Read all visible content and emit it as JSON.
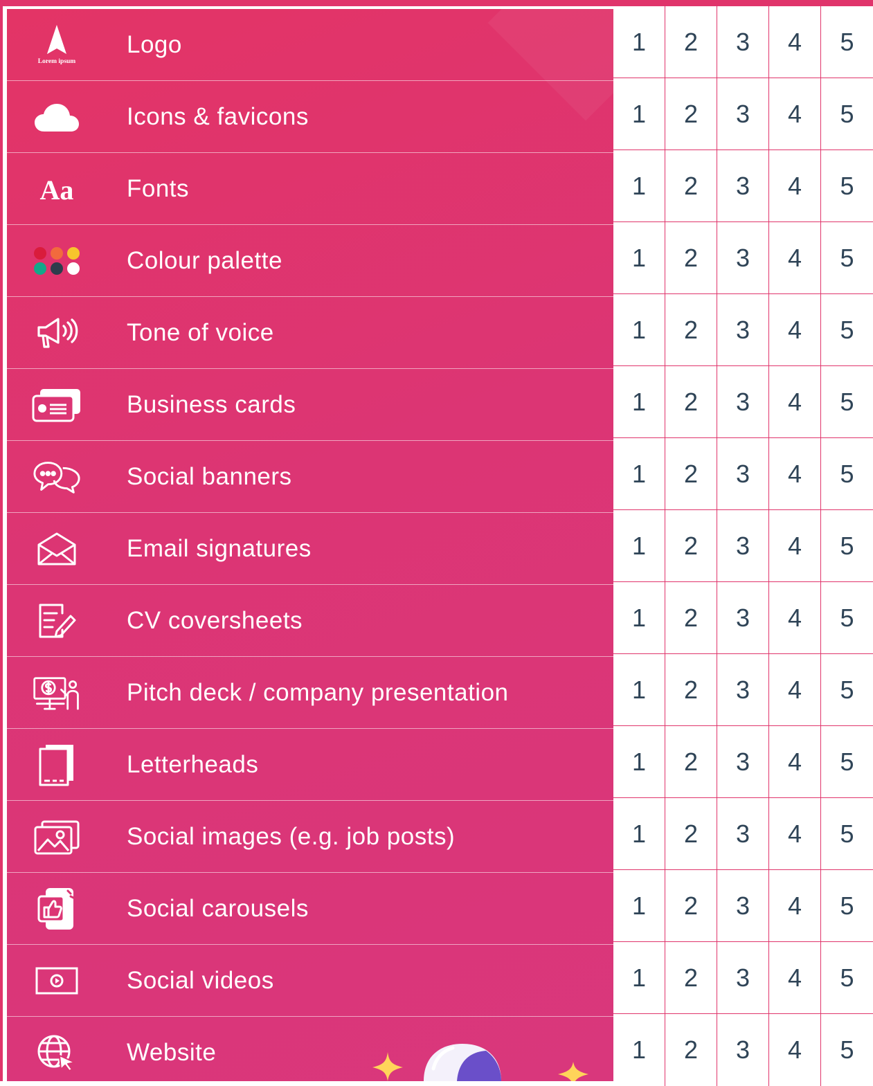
{
  "rows": [
    {
      "label": "Logo",
      "icon": "logo-icon",
      "logo_text": "Lorem ipsum"
    },
    {
      "label": "Icons & favicons",
      "icon": "cloud-icon"
    },
    {
      "label": "Fonts",
      "icon": "font-aa-icon",
      "glyph": "Aa"
    },
    {
      "label": "Colour palette",
      "icon": "palette-dots-icon"
    },
    {
      "label": "Tone of voice",
      "icon": "megaphone-icon"
    },
    {
      "label": "Business cards",
      "icon": "business-card-icon"
    },
    {
      "label": "Social banners",
      "icon": "chat-bubbles-icon"
    },
    {
      "label": "Email signatures",
      "icon": "envelope-icon"
    },
    {
      "label": "CV coversheets",
      "icon": "document-edit-icon"
    },
    {
      "label": "Pitch deck / company presentation",
      "icon": "presentation-icon"
    },
    {
      "label": "Letterheads",
      "icon": "letterhead-icon"
    },
    {
      "label": "Social images (e.g. job posts)",
      "icon": "images-icon"
    },
    {
      "label": "Social carousels",
      "icon": "phone-like-icon"
    },
    {
      "label": "Social videos",
      "icon": "video-play-icon"
    },
    {
      "label": "Website",
      "icon": "globe-cursor-icon"
    }
  ],
  "scale": [
    "1",
    "2",
    "3",
    "4",
    "5"
  ],
  "colors": {
    "panel": "#dc3574",
    "grid_border": "#e0346b",
    "number_text": "#2f4457",
    "palette": [
      "#d91c3c",
      "#f26a3d",
      "#f7c52c",
      "#14a88a",
      "#2e3c4c",
      "#ffffff"
    ]
  }
}
